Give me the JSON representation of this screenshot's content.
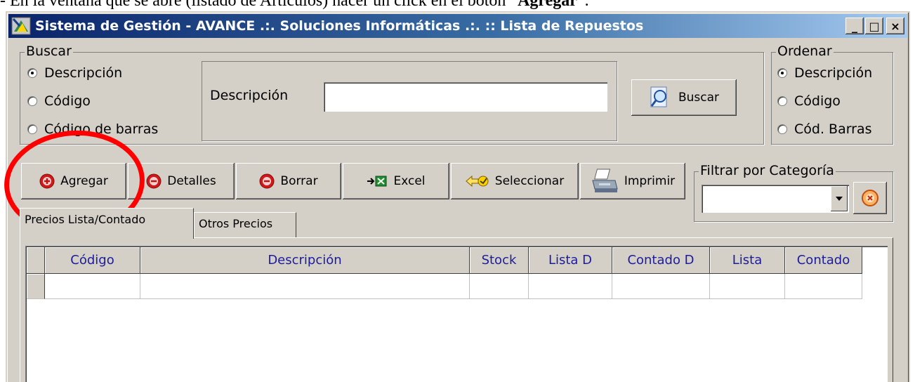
{
  "instruction": {
    "prefix": "- En la ventana que se abre (listado de Artículos) hacer un click en el botón “",
    "bold": "Agregar",
    "suffix": "”."
  },
  "window": {
    "title": "Sistema de Gestión - AVANCE .:. Soluciones Informáticas .:. :: Lista de Repuestos",
    "min_label": "_",
    "max_label": "□",
    "close_label": "×"
  },
  "buscar": {
    "legend": "Buscar",
    "options": [
      {
        "label": "Descripción",
        "checked": true
      },
      {
        "label": "Código",
        "checked": false
      },
      {
        "label": "Código de barras",
        "checked": false
      }
    ],
    "field_label": "Descripción",
    "field_value": "",
    "button_label": "Buscar"
  },
  "ordenar": {
    "legend": "Ordenar",
    "options": [
      {
        "label": "Descripción",
        "checked": true
      },
      {
        "label": "Código",
        "checked": false
      },
      {
        "label": "Cód. Barras",
        "checked": false
      }
    ]
  },
  "toolbar": {
    "agregar": "Agregar",
    "detalles": "Detalles",
    "borrar": "Borrar",
    "excel": "Excel",
    "seleccionar": "Seleccionar",
    "imprimir": "Imprimir"
  },
  "filter": {
    "legend": "Filtrar por Categoría",
    "selected": ""
  },
  "tabs": [
    {
      "label": "Precios Lista/Contado",
      "active": true
    },
    {
      "label": "Otros Precios",
      "active": false
    }
  ],
  "grid": {
    "columns": [
      "Código",
      "Descripción",
      "Stock",
      "Lista D",
      "Contado D",
      "Lista",
      "Contado"
    ],
    "rows": [
      [
        "",
        "",
        "",
        "",
        "",
        "",
        ""
      ]
    ]
  },
  "colors": {
    "window_bg": "#d4d0c8",
    "titlebar_start": "#0a246a",
    "titlebar_end": "#a6caf0",
    "header_text": "#1c1c9c",
    "highlight": "#ff0000",
    "button_icon_red": "#d01818"
  },
  "icons": {
    "agregar": "plus-circle-icon",
    "detalles": "minus-circle-icon",
    "borrar": "minus-circle-icon",
    "excel": "excel-icon",
    "seleccionar": "select-arrow-icon",
    "imprimir": "printer-icon",
    "buscar": "search-magnifier-icon",
    "clear_filter": "clear-circle-icon"
  }
}
